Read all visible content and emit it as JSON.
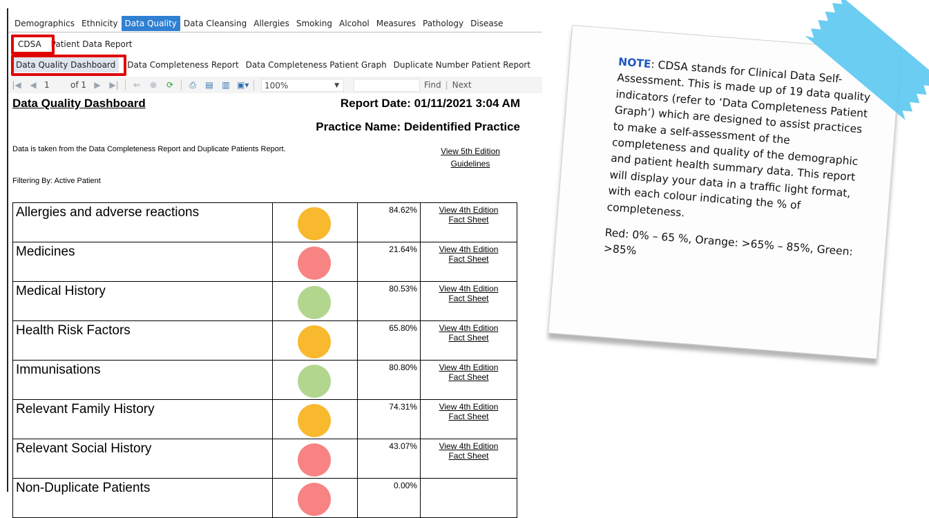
{
  "nav": {
    "tabs": [
      "Demographics",
      "Ethnicity",
      "Data Quality",
      "Data Cleansing",
      "Allergies",
      "Smoking",
      "Alcohol",
      "Measures",
      "Pathology",
      "Disease"
    ],
    "active_tab": "Data Quality",
    "sub_tabs": [
      "CDSA",
      "Patient Data Report"
    ],
    "report_tabs": [
      "Data Quality Dashboard",
      "Data Completeness Report",
      "Data Completeness Patient Graph",
      "Duplicate Number Patient Report"
    ]
  },
  "toolbar": {
    "page_current": "1",
    "page_of": "of 1",
    "zoom": "100%",
    "find_label": "Find",
    "next_label": "Next",
    "separator": "|"
  },
  "report": {
    "title": "Data Quality Dashboard",
    "report_date": "Report Date: 01/11/2021 3:04 AM",
    "practice_name": "Practice Name: Deidentified Practice",
    "source_note": "Data is taken from the Data Completeness Report and Duplicate Patients Report.",
    "guidelines_link_line1": "View 5th Edition",
    "guidelines_link_line2": "Guidelines",
    "filter": "Filtering By: Active Patient",
    "rows": [
      {
        "name": "Allergies and adverse reactions",
        "percent": "84.62%",
        "status": "orange",
        "link1": "View 4th Edition",
        "link2": "Fact Sheet"
      },
      {
        "name": "Medicines",
        "percent": "21.64%",
        "status": "red",
        "link1": "View 4th Edition",
        "link2": "Fact Sheet"
      },
      {
        "name": "Medical History",
        "percent": "80.53%",
        "status": "green",
        "link1": "View 4th Edition",
        "link2": "Fact Sheet"
      },
      {
        "name": "Health Risk Factors",
        "percent": "65.80%",
        "status": "orange",
        "link1": "View 4th Edition",
        "link2": "Fact Sheet"
      },
      {
        "name": "Immunisations",
        "percent": "80.80%",
        "status": "green",
        "link1": "View 4th Edition",
        "link2": "Fact Sheet"
      },
      {
        "name": "Relevant Family History",
        "percent": "74.31%",
        "status": "orange",
        "link1": "View 4th Edition",
        "link2": "Fact Sheet"
      },
      {
        "name": "Relevant Social History",
        "percent": "43.07%",
        "status": "red",
        "link1": "View 4th Edition",
        "link2": "Fact Sheet"
      },
      {
        "name": "Non-Duplicate Patients",
        "percent": "0.00%",
        "status": "red",
        "link1": "",
        "link2": ""
      }
    ]
  },
  "note": {
    "heading": "NOTE",
    "body": ": CDSA stands for Clinical Data Self-Assessment. This is made up of 19 data quality indicators (refer to ‘Data Completeness Patient Graph’) which are designed to assist practices to make a self-assessment of the completeness and quality of the demographic and patient health summary data. This report will display your data in a traffic light format, with each colour indicating the % of completeness.",
    "legend": "Red: 0% – 65 %, Orange: >65% – 85%, Green: >85%"
  },
  "colors": {
    "orange": "#f8b92e",
    "red": "#f78383",
    "green": "#b3d68f",
    "active_tab": "#2f7fd2",
    "highlight": "#e00000",
    "tape": "#5bc8ef"
  },
  "icons": [
    "first-page-icon",
    "prev-page-icon",
    "next-page-icon",
    "last-page-icon",
    "back-icon",
    "stop-icon",
    "refresh-icon",
    "print-icon",
    "print-layout-icon",
    "page-setup-icon",
    "export-icon"
  ]
}
